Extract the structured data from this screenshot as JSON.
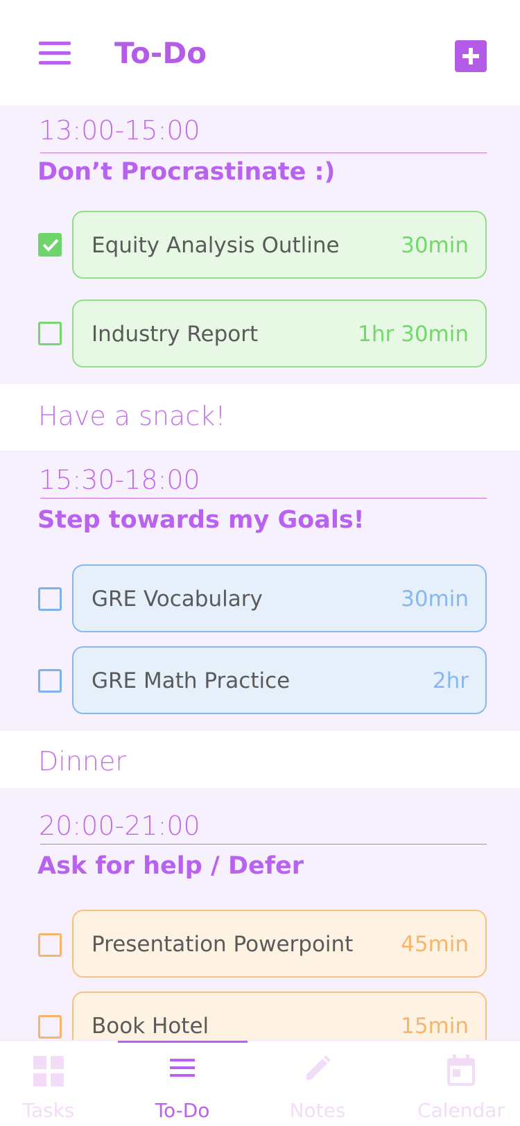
{
  "header": {
    "title": "To-Do"
  },
  "blocks": [
    {
      "time": "13:00-15:00",
      "title": "Don’t Procrastinate :)",
      "tasks": [
        {
          "name": "Equity Analysis Outline",
          "duration": "30min",
          "checked": true,
          "color": "green"
        },
        {
          "name": "Industry Report",
          "duration": "1hr 30min",
          "checked": false,
          "color": "green"
        }
      ]
    },
    {
      "time": "15:30-18:00",
      "title": "Step towards my Goals!",
      "tasks": [
        {
          "name": "GRE Vocabulary",
          "duration": "30min",
          "checked": false,
          "color": "blue"
        },
        {
          "name": "GRE Math Practice",
          "duration": "2hr",
          "checked": false,
          "color": "blue"
        }
      ]
    },
    {
      "time": "20:00-21:00",
      "title": "Ask for help / Defer",
      "tasks": [
        {
          "name": "Presentation Powerpoint",
          "duration": "45min",
          "checked": false,
          "color": "orange"
        },
        {
          "name": "Book Hotel",
          "duration": "15min",
          "checked": false,
          "color": "orange"
        }
      ]
    }
  ],
  "breaks": [
    "Have a snack!",
    "Dinner"
  ],
  "tabbar": {
    "active": "To-Do",
    "tabs": [
      {
        "label": "Tasks",
        "icon": "grid-icon"
      },
      {
        "label": "To-Do",
        "icon": "list-icon"
      },
      {
        "label": "Notes",
        "icon": "pencil-icon"
      },
      {
        "label": "Calendar",
        "icon": "calendar-icon"
      }
    ]
  },
  "colors": {
    "accent": "#b862ef",
    "green": "#74d76c",
    "blue": "#8ab6ee",
    "orange": "#f5b66b",
    "block_background": "#f7f1fd"
  }
}
